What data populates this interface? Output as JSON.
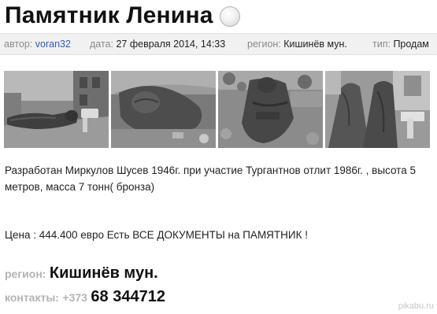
{
  "title": "Памятник Ленина",
  "meta": {
    "author_label": "автор:",
    "author": "voran32",
    "date_label": "дата:",
    "date": "27 февраля 2014, 14:33",
    "region_label": "регион:",
    "region": "Кишинёв мун.",
    "type_label": "тип:",
    "type": "Продам"
  },
  "photos": [
    {
      "icon": "toppled-statue-photo"
    },
    {
      "icon": "statue-head-photo"
    },
    {
      "icon": "statue-torso-photo"
    },
    {
      "icon": "statue-legs-photo"
    }
  ],
  "description": "Разработан Миркулов Шусев 1946г. при участие Тургантнов отлит 1986г. , высота 5 метров, масса 7 тонн( бронза)",
  "price_text": "Цена : 444.400 евро Есть ВСЕ ДОКУМЕНТЫ на ПАМЯТНИК !",
  "region_big_label": "регион:",
  "region_big_value": "Кишинёв мун.",
  "contacts_label": "контакты:",
  "phone_prefix": "+373",
  "phone_number": "68 344712",
  "watermark": "pikabu.ru"
}
